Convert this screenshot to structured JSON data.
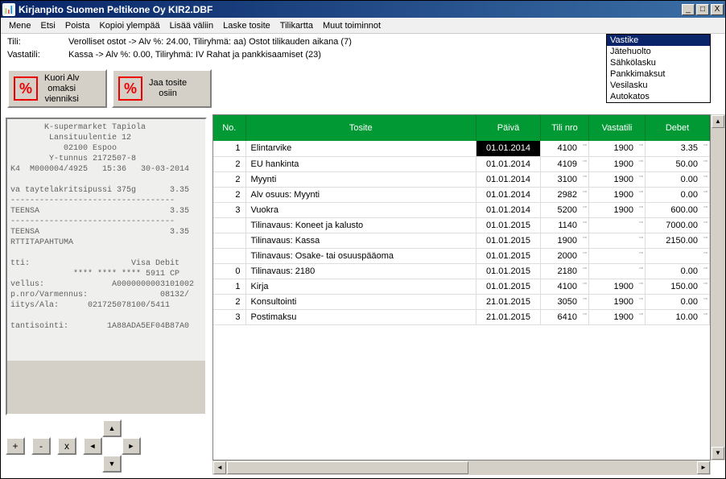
{
  "window": {
    "title": "Kirjanpito Suomen Peltikone Oy KIR2.DBF"
  },
  "menu": [
    "Mene",
    "Etsi",
    "Poista",
    "Kopioi ylempää",
    "Lisää väliin",
    "Laske tosite",
    "Tilikartta",
    "Muut toiminnot"
  ],
  "info": {
    "tili_label": "Tili:",
    "tili_value": "Verolliset ostot -> Alv %: 24.00, Tiliryhmä: aa) Ostot tilikauden aikana (7)",
    "vastatili_label": "Vastatili:",
    "vastatili_value": "Kassa -> Alv %: 0.00, Tiliryhmä: IV Rahat ja pankkisaamiset  (23)"
  },
  "side_list": [
    "Vastike",
    "Jätehuolto",
    "Sähkölasku",
    "Pankkimaksut",
    "Vesilasku",
    "Autokatos"
  ],
  "side_selected": 0,
  "buttons": {
    "kuori": "Kuori Alv\nomaksi\nvienniksi",
    "jaa": "Jaa tosite\nosiin"
  },
  "receipt_text": "       K-supermarket Tapiola\n        Lansituulentie 12\n           02100 Espoo\n        Y-tunnus 2172507-8\nK4  M000004/4925   15:36   30-03-2014\n\nva taytelakritsipussi 375g       3.35\n----------------------------------\nTEENSA                           3.35\n----------------------------------\nTEENSA                           3.35\nRTTITAPAHTUMA\n\ntti:                     Visa Debit\n             **** **** **** 5911 CP\nvellus:              A0000000003101002\np.nro/Varmennus:               08132/\niitys/Ala:      021725078100/5411\n\ntantisointi:        1A88ADA5EF04B87A0",
  "nav": {
    "plus": "+",
    "minus": "-",
    "x": "x"
  },
  "columns": [
    "No.",
    "Tosite",
    "Päivä",
    "Tili nro",
    "Vastatili",
    "Debet"
  ],
  "rows": [
    {
      "no": "1",
      "tosite": "Elintarvike",
      "paiva": "01.01.2014",
      "tili": "4100",
      "vasta": "1900",
      "debet": "3.35",
      "sel": true
    },
    {
      "no": "2",
      "tosite": "EU hankinta",
      "paiva": "01.01.2014",
      "tili": "4109",
      "vasta": "1900",
      "debet": "50.00"
    },
    {
      "no": "2",
      "tosite": "Myynti",
      "paiva": "01.01.2014",
      "tili": "3100",
      "vasta": "1900",
      "debet": "0.00"
    },
    {
      "no": "2",
      "tosite": "Alv osuus: Myynti",
      "paiva": "01.01.2014",
      "tili": "2982",
      "vasta": "1900",
      "debet": "0.00"
    },
    {
      "no": "3",
      "tosite": "Vuokra",
      "paiva": "01.01.2014",
      "tili": "5200",
      "vasta": "1900",
      "debet": "600.00"
    },
    {
      "no": "",
      "tosite": "Tilinavaus: Koneet ja kalusto",
      "paiva": "01.01.2015",
      "tili": "1140",
      "vasta": "",
      "debet": "7000.00"
    },
    {
      "no": "",
      "tosite": "Tilinavaus: Kassa",
      "paiva": "01.01.2015",
      "tili": "1900",
      "vasta": "",
      "debet": "2150.00"
    },
    {
      "no": "",
      "tosite": "Tilinavaus: Osake- tai osuuspääoma",
      "paiva": "01.01.2015",
      "tili": "2000",
      "vasta": "",
      "debet": ""
    },
    {
      "no": "0",
      "tosite": "Tilinavaus: 2180",
      "paiva": "01.01.2015",
      "tili": "2180",
      "vasta": "",
      "debet": "0.00"
    },
    {
      "no": "1",
      "tosite": "Kirja",
      "paiva": "01.01.2015",
      "tili": "4100",
      "vasta": "1900",
      "debet": "150.00"
    },
    {
      "no": "2",
      "tosite": "Konsultointi",
      "paiva": "21.01.2015",
      "tili": "3050",
      "vasta": "1900",
      "debet": "0.00"
    },
    {
      "no": "3",
      "tosite": "Postimaksu",
      "paiva": "21.01.2015",
      "tili": "6410",
      "vasta": "1900",
      "debet": "10.00"
    }
  ]
}
